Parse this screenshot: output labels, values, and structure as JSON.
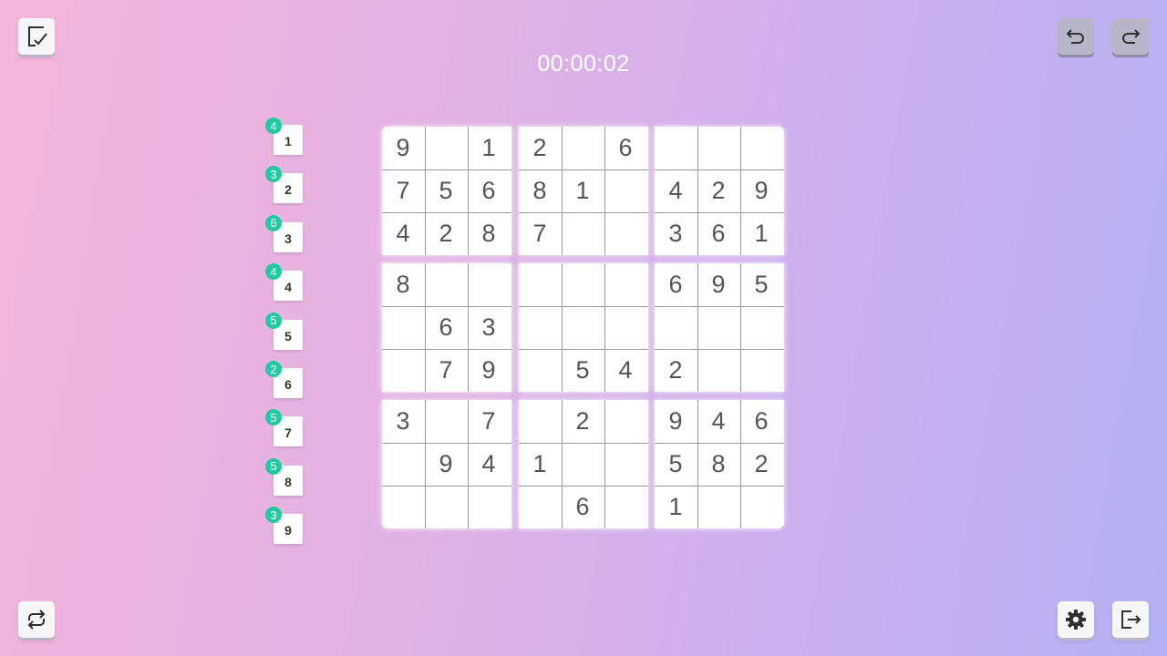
{
  "timer": "00:00:02",
  "icons": {
    "check": "check-list-icon",
    "undo": "undo-icon",
    "redo": "redo-icon",
    "restart": "restart-icon",
    "settings": "settings-gear-icon",
    "exit": "exit-icon"
  },
  "colors": {
    "badge": "#22c9a1",
    "digit": "#555555"
  },
  "number_pad": [
    {
      "digit": "1",
      "remaining": "4"
    },
    {
      "digit": "2",
      "remaining": "3"
    },
    {
      "digit": "3",
      "remaining": "6"
    },
    {
      "digit": "4",
      "remaining": "4"
    },
    {
      "digit": "5",
      "remaining": "5"
    },
    {
      "digit": "6",
      "remaining": "2"
    },
    {
      "digit": "7",
      "remaining": "5"
    },
    {
      "digit": "8",
      "remaining": "5"
    },
    {
      "digit": "9",
      "remaining": "3"
    }
  ],
  "grid": [
    [
      "9",
      "",
      "1",
      "2",
      "",
      "6",
      "",
      "",
      ""
    ],
    [
      "7",
      "5",
      "6",
      "8",
      "1",
      "",
      "4",
      "2",
      "9"
    ],
    [
      "4",
      "2",
      "8",
      "7",
      "",
      "",
      "3",
      "6",
      "1"
    ],
    [
      "8",
      "",
      "",
      "",
      "",
      "",
      "6",
      "9",
      "5"
    ],
    [
      "",
      "6",
      "3",
      "",
      "",
      "",
      "",
      "",
      ""
    ],
    [
      "",
      "7",
      "9",
      "",
      "5",
      "4",
      "2",
      "",
      ""
    ],
    [
      "3",
      "",
      "7",
      "",
      "2",
      "",
      "9",
      "4",
      "6"
    ],
    [
      "",
      "9",
      "4",
      "1",
      "",
      "",
      "5",
      "8",
      "2"
    ],
    [
      "",
      "",
      "",
      "",
      "6",
      "",
      "1",
      "",
      ""
    ]
  ]
}
